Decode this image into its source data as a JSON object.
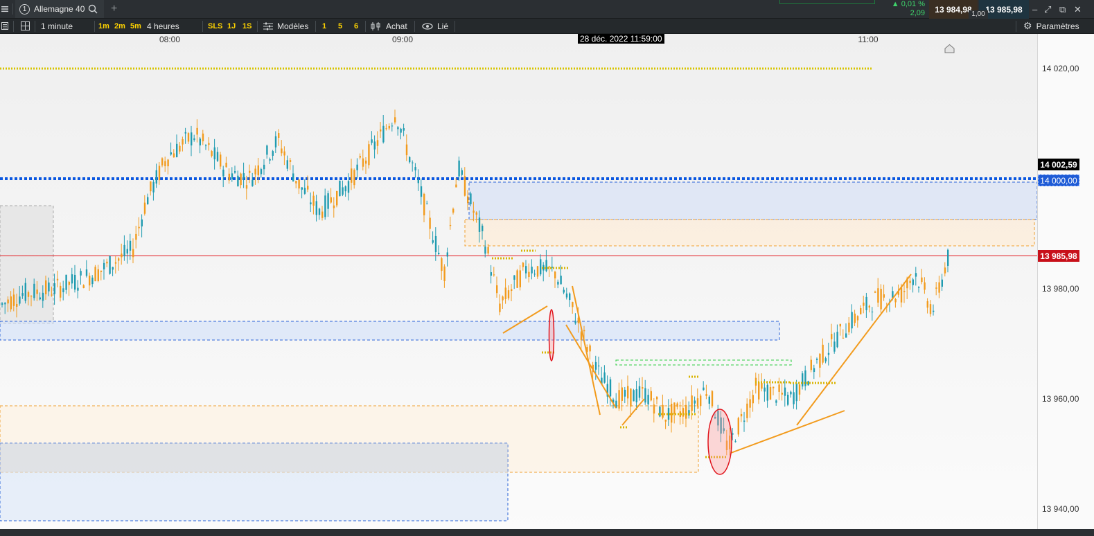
{
  "topbar": {
    "menu_icon": "hamburger-icon",
    "instrument_number": "1",
    "instrument_name": "Allemagne 40",
    "add_tab": "+",
    "change_pct": "▲ 0,01 %",
    "change_abs": "2,09",
    "bid": "13 984,98",
    "ask": "13 985,98",
    "spread": "1,00"
  },
  "toolbar": {
    "timeframe": "1 minute",
    "tf_1m": "1m",
    "tf_2m": "2m",
    "tf_5m": "5m",
    "period": "4 heures",
    "sls": "SLS",
    "d1": "1J",
    "s1": "1S",
    "models": "Modèles",
    "q1": "1",
    "q5": "5",
    "q6": "6",
    "buy": "Achat",
    "linked": "Lié",
    "settings": "Paramètres"
  },
  "chart": {
    "cursor_time": "28 déc. 2022 11:59:00",
    "x_ticks": [
      {
        "label": "08:00",
        "pos": 245
      },
      {
        "label": "09:00",
        "pos": 581
      },
      {
        "label": "11:00",
        "pos": 1253
      }
    ],
    "y_ticks": [
      "14 020,00",
      "13 980,00",
      "13 960,00",
      "13 940,00"
    ],
    "y_ticks_values": [
      14020,
      13980,
      13960,
      13940
    ],
    "tag_high": "14 002,59",
    "tag_level": "14 000,00",
    "tag_last": "13 985,98",
    "tag_high_value": 14002.59,
    "tag_level_value": 14000,
    "tag_last_value": 13985.98,
    "colors": {
      "up": "#1f9bb0",
      "down": "#f29b1d",
      "last_price": "#e3141b",
      "level_blue": "#0b57e0",
      "dotted_yellow": "#d8c400",
      "tag_red": "#c8101a",
      "tag_black": "#000000",
      "tag_blue": "#1e5bd6"
    }
  }
}
